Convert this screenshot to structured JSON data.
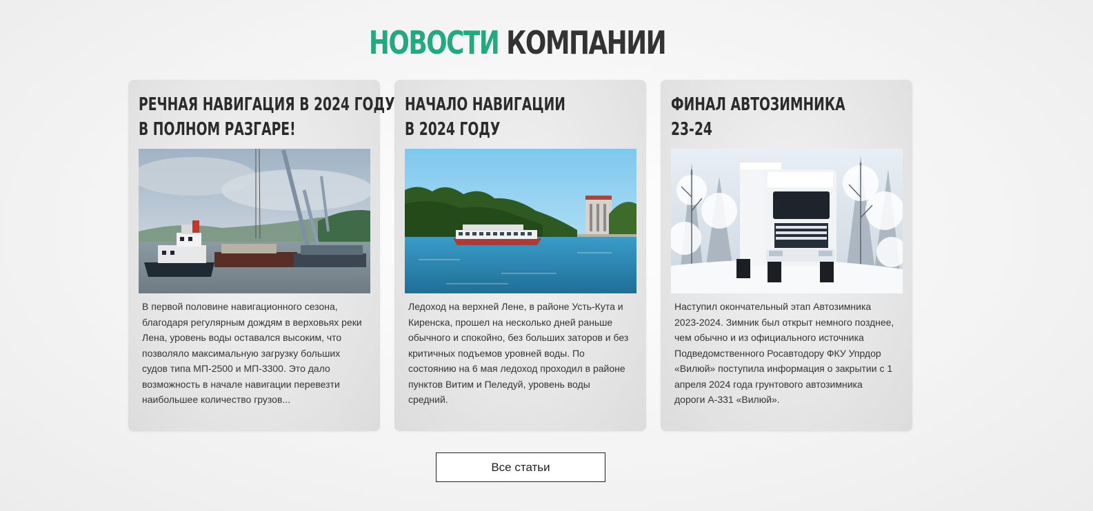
{
  "section": {
    "title_accent": "НОВОСТИ",
    "title_rest": "КОМПАНИИ"
  },
  "colors": {
    "accent": "#22aa7e",
    "heading": "#333333"
  },
  "articles": [
    {
      "title_line1": "РЕЧНАЯ НАВИГАЦИЯ В 2024 ГОДУ",
      "title_line2": "В ПОЛНОМ РАЗГАРЕ!",
      "image": "river-barge-crane-photo",
      "text": "В первой половине навигационного сезона, благодаря регулярным дождям в верховьях реки Лена, уровень воды оставался высоким, что позволяло максимальную загрузку больших судов типа МП-2500 и МП-3300. Это дало возможность в начале навигации перевезти наибольшее количество грузов..."
    },
    {
      "title_line1": "НАЧАЛО НАВИГАЦИИ",
      "title_line2": "В 2024 ГОДУ",
      "image": "river-passenger-ship-photo",
      "text": "Ледоход на верхней Лене, в районе Усть-Кута и Киренска, прошел на несколько дней раньше обычного и спокойно, без больших заторов и без критичных подъемов уровней воды. По состоянию на 6 мая ледоход проходил в районе пунктов Витим и Пеледуй, уровень воды средний."
    },
    {
      "title_line1": "ФИНАЛ АВТОЗИМНИКА",
      "title_line2": "23-24",
      "image": "snow-truck-winter-road-photo",
      "text": "Наступил окончательный этап Автозимника 2023-2024. Зимник был открыт немного позднее, чем обычно и из официального источника Подведомственного Росавтодору ФКУ Упрдор «Вилюй» поступила информация о закрытии с 1 апреля 2024 года грунтового автозимника дороги А-331 «Вилюй»."
    }
  ],
  "all_articles_button": {
    "label": "Все статьи"
  }
}
